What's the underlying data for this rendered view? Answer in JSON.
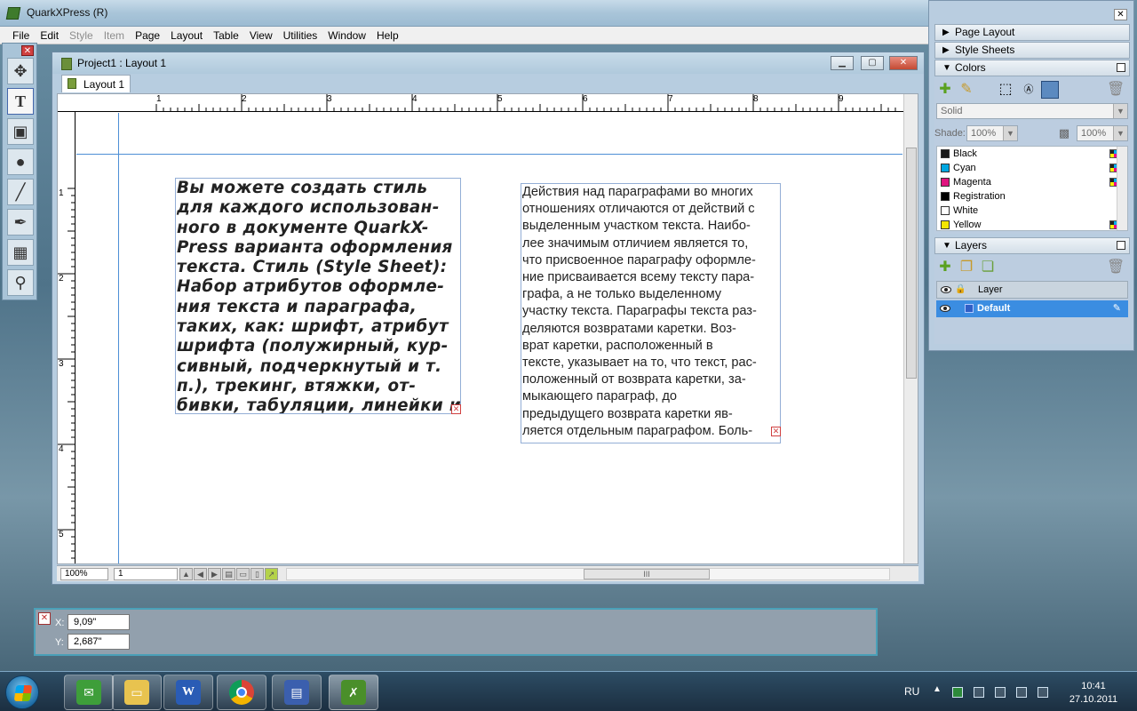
{
  "app": {
    "title": "QuarkXPress (R)"
  },
  "menubar": {
    "items": [
      "File",
      "Edit",
      "Style",
      "Item",
      "Page",
      "Layout",
      "Table",
      "View",
      "Utilities",
      "Window",
      "Help"
    ],
    "disabled": [
      "Style",
      "Item"
    ]
  },
  "tools": {
    "items": [
      "item-tool-icon",
      "text-content-tool-icon",
      "picture-content-tool-icon",
      "oval-tool-icon",
      "line-tool-icon",
      "pen-tool-icon",
      "table-tool-icon",
      "zoom-tool-icon"
    ]
  },
  "document": {
    "title": "Project1 : Layout 1",
    "tab_label": "Layout 1",
    "ruler_top_numbers": [
      "1",
      "2",
      "3",
      "4",
      "5",
      "6",
      "7",
      "8",
      "9"
    ],
    "ruler_left_numbers": [
      "1",
      "2",
      "3",
      "4",
      "5"
    ],
    "textbox1": "Вы можете создать стиль\nдля каждого использован-\nного в документе QuarkX-\nPress варианта оформления\nтекста. Стиль (Style Sheet):\nНабор атрибутов оформле-\nния текста и параграфа,\nтаких, как: шрифт, атрибут\nшрифта (полужирный, кур-\nсивный, подчеркнутый и т.\nп.), трекинг, втяжки, от-\nбивки, табуляции, линейки и",
    "textbox2": "Действия над параграфами во многих\nотношениях отличаются от действий с\nвыделенным участком текста. Наибо-\nлее значимым отличием является то,\nчто присвоенное параграфу оформле-\nние присваивается всему тексту пара-\nграфа, а не только выделенному\nучастку текста. Параграфы текста раз-\nделяются возвратами каретки. Воз-\nврат каретки, расположенный в\nтексте, указывает на то, что текст, рас-\nположенный от возврата каретки, за-\nмыкающего параграф, до\nпредыдущего возврата каретки яв-\nляется отдельным параграфом. Боль-",
    "zoom": "100%",
    "page": "1",
    "hscroll_grip": "III"
  },
  "measurements": {
    "x_label": "X:",
    "x_value": "9,09\"",
    "y_label": "Y:",
    "y_value": "2,687\""
  },
  "palettes": {
    "page_layout": "Page Layout",
    "style_sheets": "Style Sheets",
    "colors": {
      "title": "Colors",
      "fill_type": "Solid",
      "shade_label": "Shade:",
      "shade_value": "100%",
      "opacity_value": "100%",
      "list": [
        {
          "name": "Black",
          "color": "#1a1a1a",
          "cmyk": true
        },
        {
          "name": "Cyan",
          "color": "#00a7e1",
          "cmyk": true
        },
        {
          "name": "Magenta",
          "color": "#e0147f",
          "cmyk": true
        },
        {
          "name": "Registration",
          "color": "#000000",
          "cmyk": false
        },
        {
          "name": "White",
          "color": "#ffffff",
          "cmyk": false
        },
        {
          "name": "Yellow",
          "color": "#f5e600",
          "cmyk": true
        }
      ]
    },
    "layers": {
      "title": "Layers",
      "header_label": "Layer",
      "default_layer": "Default"
    }
  },
  "taskbar": {
    "apps": [
      "opera-icon",
      "explorer-icon",
      "word-icon",
      "chrome-icon",
      "save-icon",
      "quarkxpress-icon"
    ],
    "lang": "RU",
    "time": "10:41",
    "date": "27.10.2011"
  }
}
